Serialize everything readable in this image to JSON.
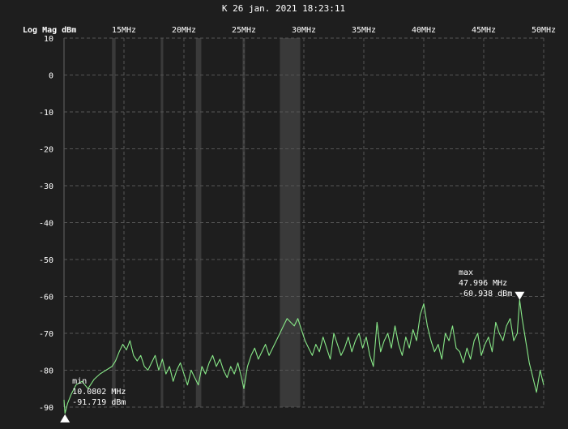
{
  "header": {
    "timestamp": "K 26 jan. 2021 18:23:11"
  },
  "chart_data": {
    "type": "line",
    "ylabel": "Log Mag dBm",
    "x_unit": "MHz",
    "xlim": [
      10,
      50
    ],
    "ylim": [
      -90,
      10
    ],
    "grid": true,
    "x_ticks": [
      {
        "value": 15,
        "label": "15MHz"
      },
      {
        "value": 20,
        "label": "20MHz"
      },
      {
        "value": 25,
        "label": "25MHz"
      },
      {
        "value": 30,
        "label": "30MHz"
      },
      {
        "value": 35,
        "label": "35MHz"
      },
      {
        "value": 40,
        "label": "40MHz"
      },
      {
        "value": 45,
        "label": "45MHz"
      },
      {
        "value": 50,
        "label": "50MHz"
      }
    ],
    "y_ticks": [
      {
        "value": 10,
        "label": "10"
      },
      {
        "value": 0,
        "label": "0"
      },
      {
        "value": -10,
        "label": "-10"
      },
      {
        "value": -20,
        "label": "-20"
      },
      {
        "value": -30,
        "label": "-30"
      },
      {
        "value": -40,
        "label": "-40"
      },
      {
        "value": -50,
        "label": "-50"
      },
      {
        "value": -60,
        "label": "-60"
      },
      {
        "value": -70,
        "label": "-70"
      },
      {
        "value": -80,
        "label": "-80"
      },
      {
        "value": -90,
        "label": "-90"
      }
    ],
    "shaded_bands": [
      {
        "from": 14.0,
        "to": 14.3
      },
      {
        "from": 18.07,
        "to": 18.17
      },
      {
        "from": 21.0,
        "to": 21.45
      },
      {
        "from": 24.89,
        "to": 24.99
      },
      {
        "from": 28.0,
        "to": 29.7
      }
    ],
    "trace_color": "#88e888",
    "series": [
      {
        "x": [
          10.0,
          10.08,
          10.3,
          10.6,
          11.0,
          11.5,
          12.0,
          12.5,
          13.0,
          13.5,
          14.0,
          14.3,
          14.6,
          14.9,
          15.2,
          15.5,
          15.8,
          16.1,
          16.4,
          16.7,
          17.0,
          17.3,
          17.6,
          17.9,
          18.2,
          18.5,
          18.8,
          19.1,
          19.4,
          19.7,
          20.0,
          20.3,
          20.6,
          20.9,
          21.2,
          21.5,
          21.8,
          22.1,
          22.4,
          22.7,
          23.0,
          23.3,
          23.6,
          23.9,
          24.2,
          24.5,
          24.8,
          25.0,
          25.3,
          25.6,
          25.9,
          26.2,
          26.5,
          26.8,
          27.1,
          27.4,
          27.7,
          28.0,
          28.3,
          28.6,
          28.9,
          29.2,
          29.5,
          29.8,
          30.1,
          30.4,
          30.7,
          31.0,
          31.3,
          31.6,
          31.9,
          32.2,
          32.5,
          32.8,
          33.1,
          33.4,
          33.7,
          34.0,
          34.3,
          34.6,
          34.9,
          35.2,
          35.5,
          35.8,
          36.1,
          36.4,
          36.7,
          37.0,
          37.3,
          37.6,
          37.9,
          38.2,
          38.5,
          38.8,
          39.1,
          39.4,
          39.7,
          40.0,
          40.3,
          40.6,
          40.9,
          41.2,
          41.5,
          41.8,
          42.1,
          42.4,
          42.7,
          43.0,
          43.3,
          43.6,
          43.9,
          44.2,
          44.5,
          44.8,
          45.1,
          45.4,
          45.7,
          46.0,
          46.3,
          46.6,
          46.9,
          47.2,
          47.5,
          47.8,
          47.996,
          48.2,
          48.5,
          48.8,
          49.1,
          49.4,
          49.7,
          50.0
        ],
        "y": [
          -88.0,
          -91.719,
          -89.0,
          -86.5,
          -84.0,
          -83.0,
          -85.0,
          -82.5,
          -81.0,
          -80.0,
          -79.0,
          -77.5,
          -75.0,
          -73.0,
          -74.5,
          -72.0,
          -76.0,
          -77.5,
          -76.0,
          -79.0,
          -80.0,
          -78.0,
          -76.0,
          -80.0,
          -77.0,
          -81.0,
          -79.0,
          -83.0,
          -80.0,
          -78.0,
          -81.0,
          -84.0,
          -80.0,
          -82.0,
          -84.0,
          -79.0,
          -81.0,
          -78.0,
          -76.0,
          -79.0,
          -77.0,
          -80.0,
          -82.0,
          -79.0,
          -81.0,
          -78.0,
          -82.0,
          -85.0,
          -79.0,
          -76.0,
          -74.0,
          -77.0,
          -75.0,
          -73.0,
          -76.0,
          -74.0,
          -72.0,
          -70.0,
          -68.0,
          -66.0,
          -67.0,
          -68.0,
          -66.0,
          -69.0,
          -72.0,
          -74.0,
          -76.0,
          -73.0,
          -75.0,
          -71.0,
          -74.0,
          -77.0,
          -70.0,
          -73.0,
          -76.0,
          -74.0,
          -71.0,
          -75.0,
          -72.0,
          -70.0,
          -74.0,
          -71.0,
          -76.0,
          -79.0,
          -67.0,
          -75.0,
          -72.0,
          -70.0,
          -74.0,
          -68.0,
          -73.0,
          -76.0,
          -71.0,
          -74.0,
          -69.0,
          -72.0,
          -65.0,
          -62.0,
          -68.0,
          -72.0,
          -75.0,
          -73.0,
          -77.0,
          -70.0,
          -72.0,
          -68.0,
          -74.0,
          -75.0,
          -78.0,
          -74.0,
          -77.0,
          -72.0,
          -70.0,
          -76.0,
          -73.0,
          -71.0,
          -75.0,
          -67.0,
          -70.0,
          -72.0,
          -68.0,
          -66.0,
          -72.0,
          -70.0,
          -60.938,
          -66.0,
          -72.0,
          -78.0,
          -82.0,
          -86.0,
          -80.0,
          -84.0
        ]
      }
    ],
    "markers": [
      {
        "type": "min",
        "x": 10.0802,
        "y": -91.719,
        "label": "min",
        "freq_text": "10.0802 MHz",
        "value_text": "-91.719 dBm"
      },
      {
        "type": "max",
        "x": 47.996,
        "y": -60.938,
        "label": "max",
        "freq_text": "47.996 MHz",
        "value_text": "-60.938 dBm"
      }
    ]
  }
}
